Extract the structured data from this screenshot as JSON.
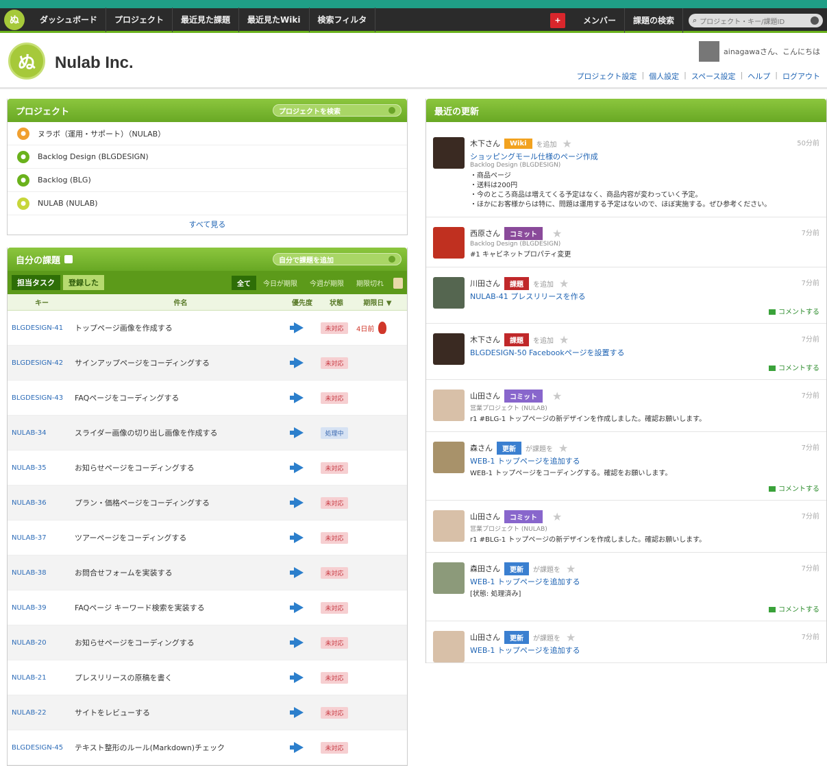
{
  "nav": {
    "logo_glyph": "ぬ",
    "items": [
      "ダッシュボード",
      "プロジェクト",
      "最近見た課題",
      "最近見たWiki",
      "検索フィルタ"
    ],
    "plus_label": "+",
    "right_items": [
      "メンバー",
      "課題の検索"
    ],
    "search_placeholder": "プロジェクト・キー/課題ID"
  },
  "header": {
    "logo_glyph": "ぬ",
    "company": "Nulab Inc.",
    "user_greeting": "ainagawaさん、こんにちは",
    "links": [
      "プロジェクト設定",
      "個人設定",
      "スペース設定",
      "ヘルプ",
      "ログアウト"
    ]
  },
  "projects": {
    "title": "プロジェクト",
    "button_label": "プロジェクトを検索",
    "items": [
      {
        "name": "ヌラボ（運用・サポート）（NULAB）",
        "color": "#f0a030",
        "glyph": "●"
      },
      {
        "name": "Backlog Design (BLGDESIGN)",
        "color": "#6ab21c",
        "glyph": "●"
      },
      {
        "name": "Backlog (BLG)",
        "color": "#6ab21c",
        "glyph": "●"
      },
      {
        "name": "NULAB (NULAB)",
        "color": "#c7d63a",
        "glyph": "●"
      }
    ],
    "see_all": "すべて見る"
  },
  "issues": {
    "title": "自分の課題",
    "button_label": "自分で課題を追加",
    "tabs": [
      "担当タスク",
      "登録した"
    ],
    "filters": [
      "全て",
      "今日が期限",
      "今週が期限",
      "期限切れ"
    ],
    "columns": [
      "キー",
      "件名",
      "優先度",
      "状態",
      "期限日 ▼"
    ],
    "rows": [
      {
        "key": "BLGDESIGN-41",
        "subject": "トップページ画像を作成する",
        "status": "未対応",
        "status_type": "red",
        "due": "4日前",
        "fire": true
      },
      {
        "key": "BLGDESIGN-42",
        "subject": "サインアップページをコーディングする",
        "status": "未対応",
        "status_type": "red",
        "due": "",
        "fire": false
      },
      {
        "key": "BLGDESIGN-43",
        "subject": "FAQページをコーディングする",
        "status": "未対応",
        "status_type": "red",
        "due": "",
        "fire": false
      },
      {
        "key": "NULAB-34",
        "subject": "スライダー画像の切り出し画像を作成する",
        "status": "処理中",
        "status_type": "blue",
        "due": "",
        "fire": false
      },
      {
        "key": "NULAB-35",
        "subject": "お知らせページをコーディングする",
        "status": "未対応",
        "status_type": "red",
        "due": "",
        "fire": false
      },
      {
        "key": "NULAB-36",
        "subject": "プラン・価格ページをコーディングする",
        "status": "未対応",
        "status_type": "red",
        "due": "",
        "fire": false
      },
      {
        "key": "NULAB-37",
        "subject": "ツアーページをコーディングする",
        "status": "未対応",
        "status_type": "red",
        "due": "",
        "fire": false
      },
      {
        "key": "NULAB-38",
        "subject": "お問合せフォームを実装する",
        "status": "未対応",
        "status_type": "red",
        "due": "",
        "fire": false
      },
      {
        "key": "NULAB-39",
        "subject": "FAQページ キーワード検索を実装する",
        "status": "未対応",
        "status_type": "red",
        "due": "",
        "fire": false
      },
      {
        "key": "NULAB-20",
        "subject": "お知らせページをコーディングする",
        "status": "未対応",
        "status_type": "red",
        "due": "",
        "fire": false
      },
      {
        "key": "NULAB-21",
        "subject": "プレスリリースの原稿を書く",
        "status": "未対応",
        "status_type": "red",
        "due": "",
        "fire": false
      },
      {
        "key": "NULAB-22",
        "subject": "サイトをレビューする",
        "status": "未対応",
        "status_type": "red",
        "due": "",
        "fire": false
      },
      {
        "key": "BLGDESIGN-45",
        "subject": "テキスト整形のルール(Markdown)チェック",
        "status": "未対応",
        "status_type": "red",
        "due": "",
        "fire": false
      }
    ]
  },
  "feed": {
    "title": "最近の更新",
    "items": [
      {
        "user": "木下さん",
        "tag": "Wiki",
        "tag_color": "#f2a21f",
        "action": "を追加",
        "time": "50分前",
        "avatar": "#3a2a22",
        "link": "ショッピングモール仕様のページ作成",
        "project": "Backlog Design (BLGDESIGN)",
        "body": "・商品ページ\n・送料は200円\n・今のところ商品は増えてくる予定はなく、商品内容が変わっていく予定。\n・ほかにお客様からは特に、問題は運用する予定はないので、ほぼ実施する。ぜひ参考ください。",
        "comment": ""
      },
      {
        "user": "西原さん",
        "tag": "コミット",
        "tag_color": "#8a4a9a",
        "action": "",
        "time": "7分前",
        "avatar": "#c03020",
        "link": "",
        "project": "Backlog Design (BLGDESIGN)",
        "body": "#1 キャビネットプロパティ変更",
        "comment": ""
      },
      {
        "user": "川田さん",
        "tag": "課題",
        "tag_color": "#c0282a",
        "action": "を追加",
        "time": "7分前",
        "avatar": "#556650",
        "link": "NULAB-41 プレスリリースを作る",
        "project": "",
        "body": "",
        "comment": "コメントする"
      },
      {
        "user": "木下さん",
        "tag": "課題",
        "tag_color": "#c0282a",
        "action": "を追加",
        "time": "7分前",
        "avatar": "#3a2a22",
        "link": "BLGDESIGN-50 Facebookページを設置する",
        "project": "",
        "body": "",
        "comment": "コメントする"
      },
      {
        "user": "山田さん",
        "tag": "コミット",
        "tag_color": "#8866cc",
        "action": "",
        "time": "7分前",
        "avatar": "#d8c0a8",
        "link": "",
        "project": "営業プロジェクト (NULAB)",
        "body": "r1  #BLG-1 トップページの新デザインを作成しました。確認お願いします。",
        "comment": ""
      },
      {
        "user": "森さん",
        "tag": "更新",
        "tag_color": "#3a7fd0",
        "action": "が課題を",
        "time": "7分前",
        "avatar": "#a8926a",
        "link": "WEB-1 トップページを追加する",
        "project": "",
        "body": "WEB-1 トップページをコーディングする。確認をお願いします。",
        "comment": "コメントする"
      },
      {
        "user": "山田さん",
        "tag": "コミット",
        "tag_color": "#8866cc",
        "action": "",
        "time": "7分前",
        "avatar": "#d8c0a8",
        "link": "",
        "project": "営業プロジェクト (NULAB)",
        "body": "r1  #BLG-1 トップページの新デザインを作成しました。確認お願いします。",
        "comment": ""
      },
      {
        "user": "森田さん",
        "tag": "更新",
        "tag_color": "#3a7fd0",
        "action": "が課題を",
        "time": "7分前",
        "avatar": "#8c9a7a",
        "link": "WEB-1 トップページを追加する",
        "project": "",
        "body": "[状態: 処理済み]",
        "comment": "コメントする"
      },
      {
        "user": "山田さん",
        "tag": "更新",
        "tag_color": "#3a7fd0",
        "action": "が課題を",
        "time": "7分前",
        "avatar": "#d8c0a8",
        "link": "WEB-1 トップページを追加する",
        "project": "",
        "body": "",
        "comment": ""
      }
    ]
  }
}
